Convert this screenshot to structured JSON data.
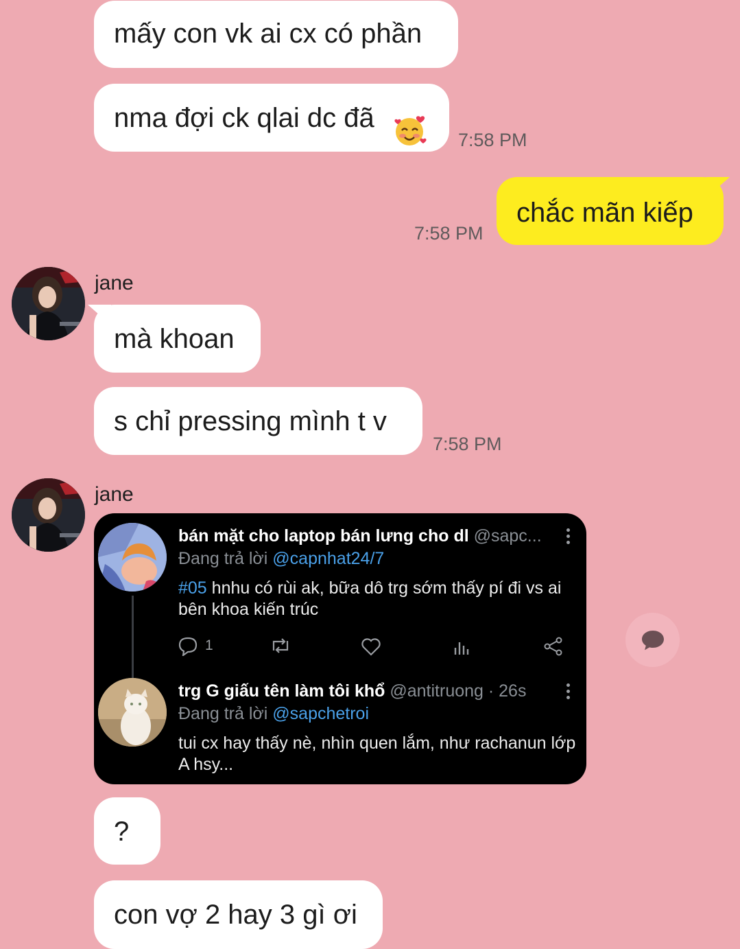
{
  "messages": {
    "m1": "mấy con vk ai cx có phần",
    "m2": "nma đợi ck qlai dc đã",
    "m2_time": "7:58 PM",
    "m3": "chắc mãn kiếp",
    "m3_time": "7:58 PM",
    "sender1": "jane",
    "m4": "mà khoan",
    "m5": "s chỉ pressing mình t v",
    "m5_time": "7:58 PM",
    "sender2": "jane",
    "m6": "?",
    "m7": "con vợ 2 hay 3 gì ơi"
  },
  "tweet": {
    "t1_name": "bán mặt cho laptop bán lưng cho dl",
    "t1_handle": "@sapc...",
    "t1_reply_prefix": "Đang trả lời",
    "t1_reply_to": "@capnhat24/7",
    "t1_hashtag": "#05",
    "t1_body": "hnhu có rùi ak, bữa dô trg sớm thấy pí đi vs ai bên khoa kiến trúc",
    "t1_reply_count": "1",
    "t2_name": "trg G giấu tên làm tôi khổ",
    "t2_handle": "@antitruong · 26s",
    "t2_reply_prefix": "Đang trả lời",
    "t2_reply_to": "@sapchetroi",
    "t2_body": "tui cx hay thấy nè, nhìn quen lắm, như rachanun lớp A hsy..."
  },
  "icons": {
    "emoji": "smiling-face-with-hearts-icon",
    "share": "chat-bubble-icon"
  }
}
